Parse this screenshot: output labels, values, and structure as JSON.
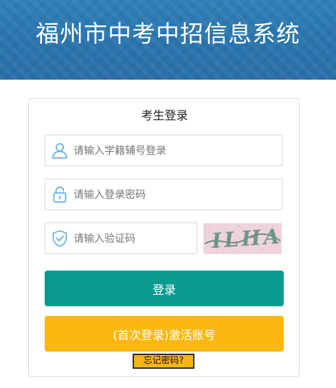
{
  "header": {
    "title": "福州市中考中招信息系统"
  },
  "login": {
    "title": "考生登录",
    "username_placeholder": "请输入学籍辅号登录",
    "username_icon": "user-icon",
    "password_placeholder": "请输入登录密码",
    "password_icon": "lock-icon",
    "captcha_placeholder": "请输入验证码",
    "captcha_icon": "shield-check-icon",
    "captcha_text": "ILHA",
    "login_button": "登录",
    "activate_button": "(首次登录)激活账号",
    "forgot_password": "忘记密码?"
  },
  "colors": {
    "header_blue": "#2a74ad",
    "icon_blue": "#5aaee0",
    "login_green": "#0a9b8f",
    "activate_yellow": "#fcb713"
  }
}
